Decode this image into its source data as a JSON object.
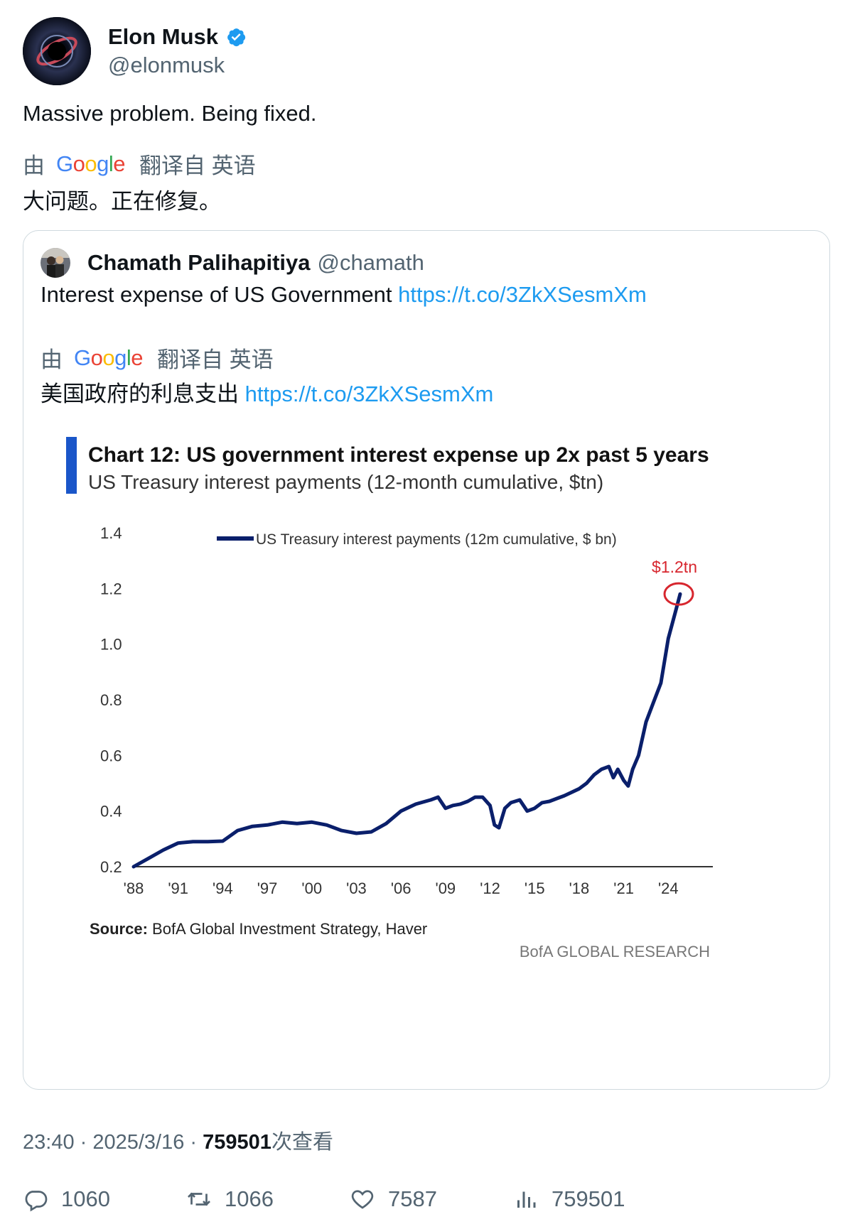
{
  "author": {
    "name": "Elon Musk",
    "handle": "@elonmusk"
  },
  "tweet": {
    "text": "Massive problem. Being fixed.",
    "translate": {
      "prefix": "由",
      "google": "Google",
      "suffix": "翻译自 英语"
    },
    "translated_text": "大问题。正在修复。"
  },
  "quote": {
    "name": "Chamath Palihapitiya",
    "handle": "@chamath",
    "text": "Interest expense of US Government ",
    "link": "https://t.co/3ZkXSesmXm",
    "translate": {
      "prefix": "由",
      "google": "Google",
      "suffix": "翻译自 英语"
    },
    "translated_text": "美国政府的利息支出 ",
    "translated_link": "https://t.co/3ZkXSesmXm"
  },
  "chart_data": {
    "type": "line",
    "title": "Chart 12: US government interest expense up 2x past 5 years",
    "subtitle": "US Treasury interest payments (12-month cumulative, $tn)",
    "series": [
      {
        "name": "US Treasury interest payments (12m cumulative, $ bn)",
        "color": "#0a1f6b",
        "x": [
          1988,
          1989,
          1990,
          1991,
          1992,
          1993,
          1994,
          1995,
          1996,
          1997,
          1998,
          1999,
          2000,
          2001,
          2002,
          2003,
          2004,
          2005,
          2006,
          2007,
          2008,
          2008.5,
          2009,
          2009.5,
          2010,
          2010.5,
          2011,
          2011.5,
          2012,
          2012.3,
          2012.6,
          2013,
          2013.4,
          2014,
          2014.5,
          2015,
          2015.5,
          2016,
          2016.5,
          2017,
          2018,
          2018.5,
          2019,
          2019.5,
          2020,
          2020.3,
          2020.6,
          2021,
          2021.3,
          2021.6,
          2022,
          2022.5,
          2023,
          2023.5,
          2024,
          2024.5,
          2024.8
        ],
        "y": [
          0.2,
          0.23,
          0.26,
          0.285,
          0.29,
          0.29,
          0.292,
          0.33,
          0.345,
          0.35,
          0.36,
          0.355,
          0.36,
          0.35,
          0.33,
          0.32,
          0.325,
          0.355,
          0.4,
          0.425,
          0.44,
          0.45,
          0.41,
          0.42,
          0.425,
          0.435,
          0.45,
          0.45,
          0.42,
          0.35,
          0.34,
          0.41,
          0.43,
          0.44,
          0.4,
          0.41,
          0.43,
          0.435,
          0.445,
          0.455,
          0.48,
          0.5,
          0.53,
          0.55,
          0.56,
          0.52,
          0.55,
          0.51,
          0.49,
          0.55,
          0.6,
          0.72,
          0.79,
          0.86,
          1.02,
          1.12,
          1.18
        ]
      }
    ],
    "x_ticks": [
      "'88",
      "'91",
      "'94",
      "'97",
      "'00",
      "'03",
      "'06",
      "'09",
      "'12",
      "'15",
      "'18",
      "'21",
      "'24"
    ],
    "y_ticks": [
      "1.4",
      "1.2",
      "1.0",
      "0.8",
      "0.6",
      "0.4",
      "0.2"
    ],
    "ylim": [
      0.2,
      1.4
    ],
    "xlim": [
      1988,
      2027
    ],
    "annotation": "$1.2tn",
    "source_label": "Source:",
    "source_text": " BofA Global Investment Strategy, Haver",
    "brand": "BofA GLOBAL RESEARCH",
    "grid": false,
    "legend": "top",
    "colors": {
      "accent_bar": "#1a56c9",
      "line": "#0a1f6b",
      "annotation": "#d7262e"
    }
  },
  "meta": {
    "time": "23:40",
    "sep": " · ",
    "date": "2025/3/16",
    "views": "759501",
    "views_suffix": "次查看"
  },
  "actions": {
    "replies": "1060",
    "retweets": "1066",
    "likes": "7587",
    "views": "759501"
  }
}
